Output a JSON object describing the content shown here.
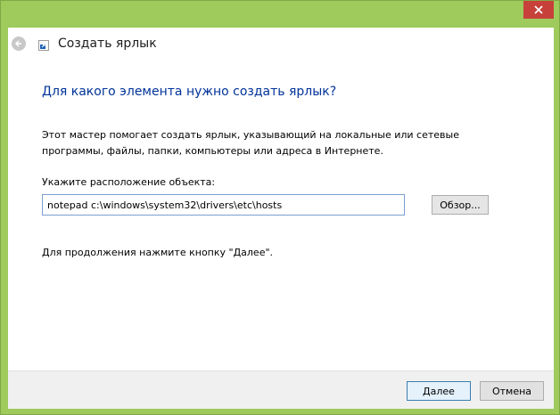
{
  "window": {
    "title": "Создать ярлык",
    "frame_color": "#9fca5c",
    "close_color": "#c7413a"
  },
  "titlebar": {
    "back_icon": "back-arrow-icon",
    "app_icon": "shortcut-icon",
    "close_icon": "close-icon"
  },
  "main": {
    "heading": "Для какого элемента нужно создать ярлык?",
    "heading_color": "#003399",
    "description": "Этот мастер помогает создать ярлык, указывающий на локальные или сетевые программы, файлы, папки, компьютеры или адреса в Интернете.",
    "location_label": "Укажите расположение объекта:",
    "location_value": "notepad c:\\windows\\system32\\drivers\\etc\\hosts",
    "browse_label": "Обзор...",
    "hint": "Для продолжения нажмите кнопку \"Далее\"."
  },
  "footer": {
    "next_label": "Далее",
    "cancel_label": "Отмена"
  }
}
